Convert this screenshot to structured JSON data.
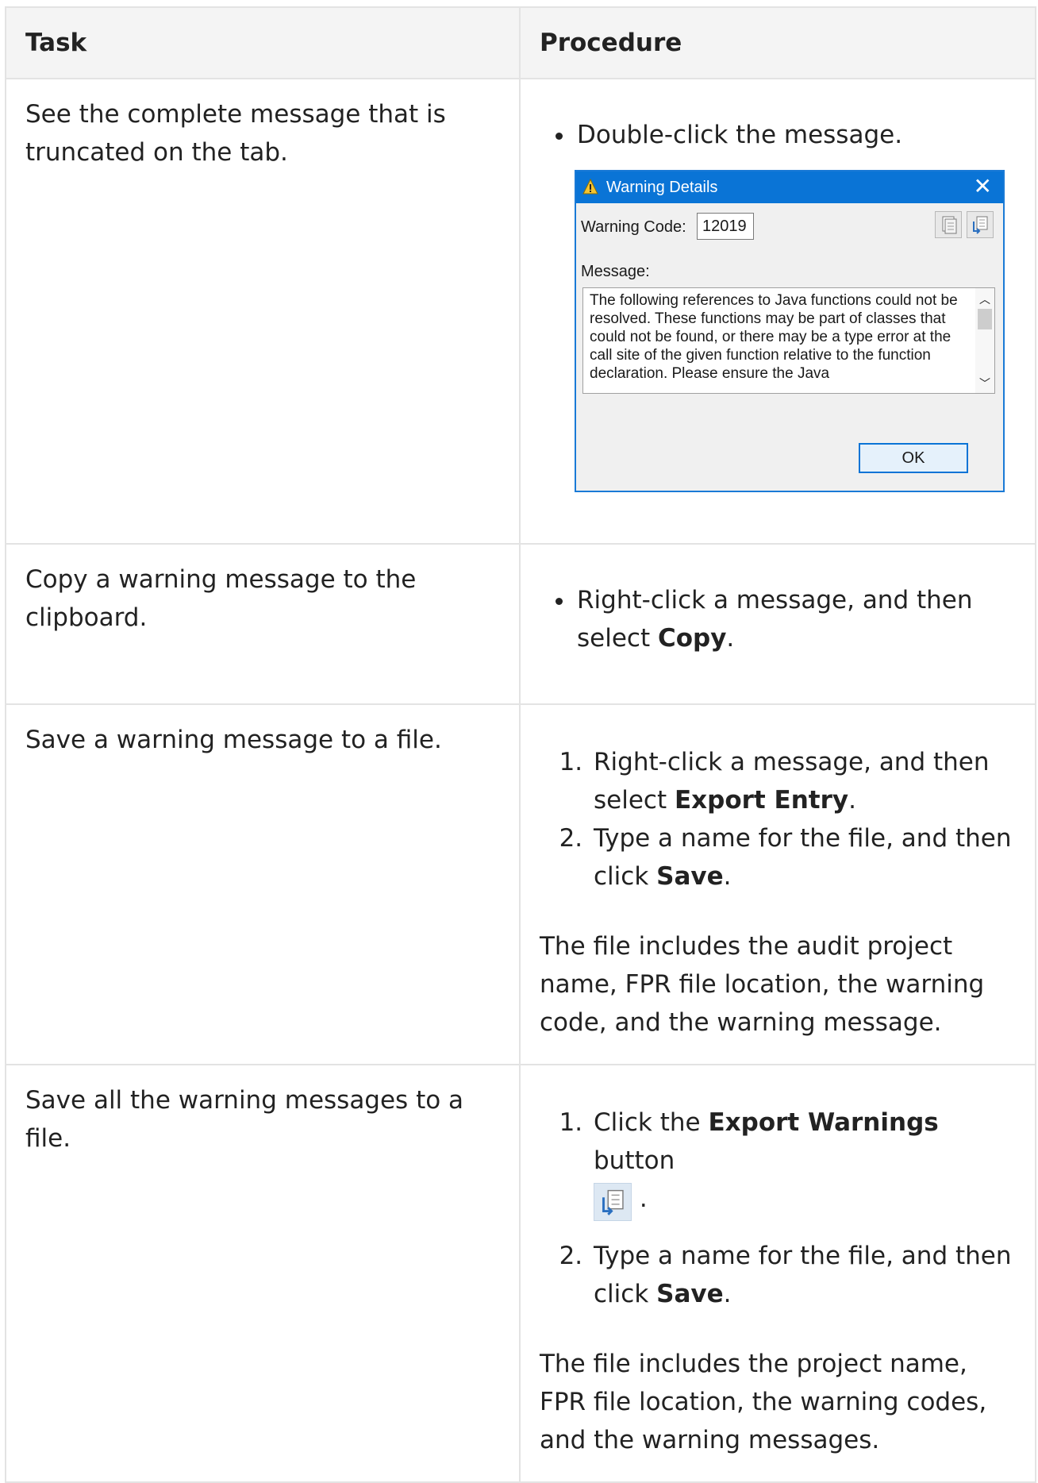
{
  "table": {
    "headers": [
      "Task",
      "Procedure"
    ],
    "rows": [
      {
        "task": "See the complete message that is truncated on the tab.",
        "steps": [
          "Double-click the message."
        ]
      },
      {
        "task": "Copy a warning message to the clipboard.",
        "step_pre": "Right-click a message, and then select ",
        "step_bold": "Copy",
        "step_post": "."
      },
      {
        "task": "Save a warning message to a file.",
        "step1_pre": "Right-click a message, and then select ",
        "step1_bold": "Export Entry",
        "step1_post": ".",
        "step2_pre": "Type a name for the file, and then click ",
        "step2_bold": "Save",
        "step2_post": ".",
        "note": "The file includes the audit project name, FPR file location, the warning code, and the warning message."
      },
      {
        "task": "Save all the warning messages to a file.",
        "step1_pre": "Click the ",
        "step1_bold": "Export Warnings",
        "step1_post": " button",
        "step1_after_icon": ".",
        "step2_pre": "Type a name for the file, and then click ",
        "step2_bold": "Save",
        "step2_post": ".",
        "note": "The file includes the project name, FPR file location, the warning codes, and the warning messages."
      }
    ]
  },
  "dialog": {
    "title": "Warning Details",
    "code_label": "Warning Code:",
    "code_value": "12019",
    "message_label": "Message:",
    "message_text": "The following references to Java functions could not be resolved. These functions may be part of classes that could not be found, or there may be a type error at the call site of the given function relative to the function declaration. Please ensure the Java",
    "ok_label": "OK",
    "close_glyph": "✕"
  },
  "icons": {
    "warning": "warning-triangle-icon",
    "copy": "copy-icon",
    "export": "export-warnings-icon"
  },
  "colors": {
    "titlebar": "#0a74d6",
    "accent": "#1a7ad6"
  }
}
